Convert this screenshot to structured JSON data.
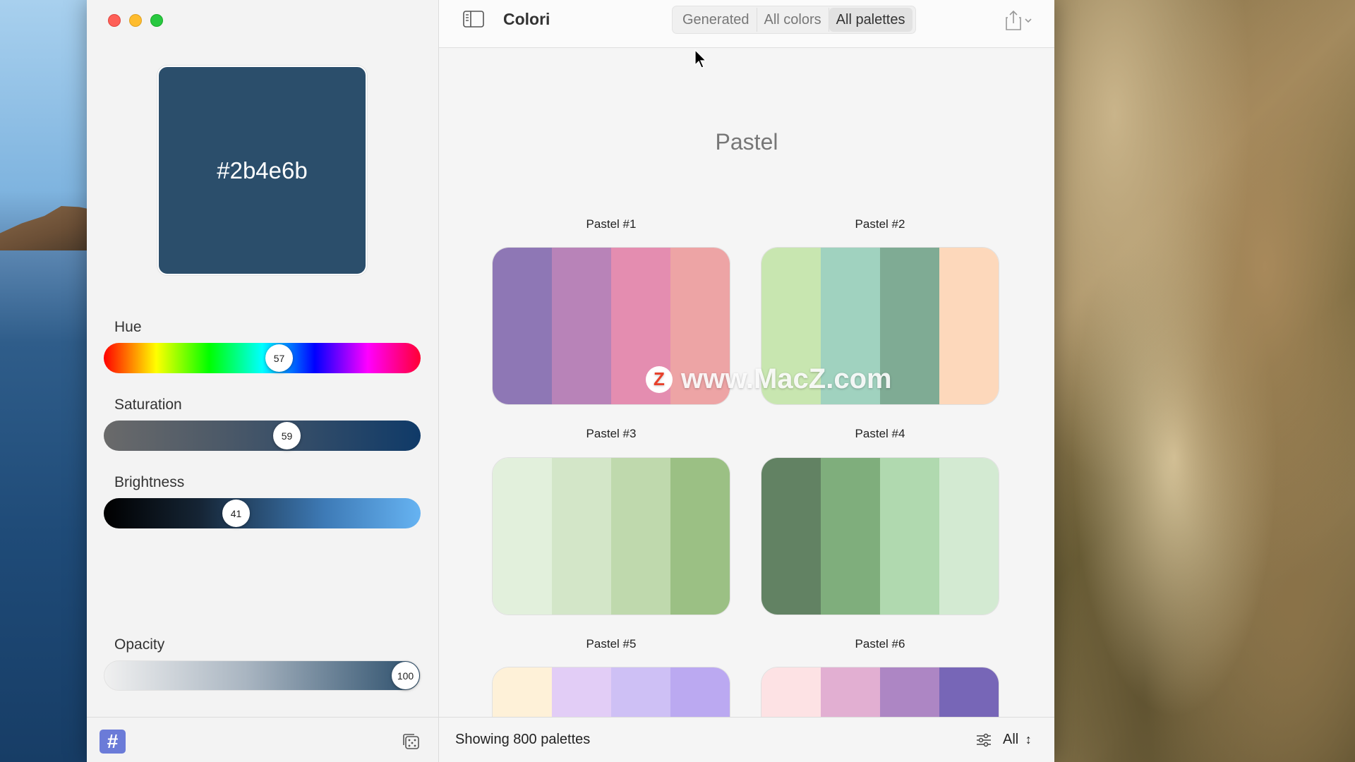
{
  "app": {
    "title": "Colori"
  },
  "color": {
    "hex": "#2b4e6b"
  },
  "sliders": {
    "hue": {
      "label": "Hue",
      "value": "57"
    },
    "saturation": {
      "label": "Saturation",
      "value": "59"
    },
    "brightness": {
      "label": "Brightness",
      "value": "41"
    },
    "opacity": {
      "label": "Opacity",
      "value": "100"
    }
  },
  "sidebar_bottom": {
    "hash_label": "#"
  },
  "tabs": [
    {
      "label": "Generated"
    },
    {
      "label": "All colors"
    },
    {
      "label": "All palettes",
      "active": true
    }
  ],
  "section": {
    "title": "Pastel"
  },
  "palettes": [
    {
      "name": "Pastel #1",
      "colors": [
        "#8e77b5",
        "#b883b8",
        "#e48db0",
        "#eda4a5"
      ]
    },
    {
      "name": "Pastel #2",
      "colors": [
        "#c8e6b0",
        "#a0d2bf",
        "#7fab94",
        "#fdd8bb"
      ]
    },
    {
      "name": "Pastel #3",
      "colors": [
        "#e2f0dc",
        "#d3e6c8",
        "#bfd9ad",
        "#9bc084"
      ]
    },
    {
      "name": "Pastel #4",
      "colors": [
        "#628263",
        "#7fae7c",
        "#b0d9af",
        "#d3ead2"
      ]
    },
    {
      "name": "Pastel #5",
      "colors": [
        "#fef1d8",
        "#e2cdf6",
        "#cec0f5",
        "#bba9f1"
      ]
    },
    {
      "name": "Pastel #6",
      "colors": [
        "#fde2e4",
        "#e2afd2",
        "#ad86c4",
        "#7766b7"
      ]
    }
  ],
  "watermark": {
    "text": "www.MacZ.com",
    "badge": "Z"
  },
  "status": {
    "text": "Showing 800 palettes",
    "filter": "All"
  },
  "icons": {
    "sidebar_toggle": "sidebar-icon",
    "share": "share-icon",
    "dice": "random-dice-icon",
    "filter": "sliders-icon"
  }
}
